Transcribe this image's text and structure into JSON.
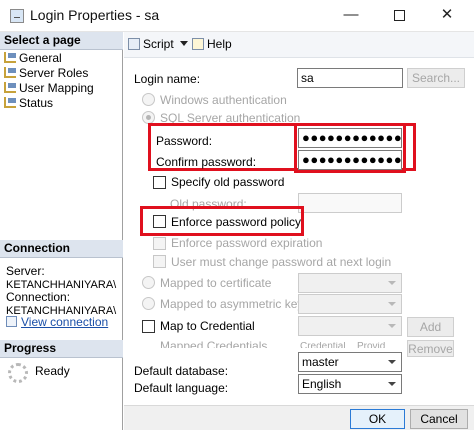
{
  "window": {
    "title": "Login Properties - sa",
    "minimize": "—",
    "close": "✕"
  },
  "left": {
    "select_page_header": "Select a page",
    "pages": [
      {
        "label": "General"
      },
      {
        "label": "Server Roles"
      },
      {
        "label": "User Mapping"
      },
      {
        "label": "Status"
      }
    ],
    "connection_header": "Connection",
    "server_label": "Server:",
    "server_value": "KETANCHHANIYARA\\",
    "connection_label": "Connection:",
    "connection_value": "KETANCHHANIYARA\\",
    "view_connection": "View connection",
    "progress_header": "Progress",
    "progress_status": "Ready"
  },
  "toolbar": {
    "script_label": "Script",
    "help_label": "Help"
  },
  "form": {
    "login_name_label": "Login name:",
    "login_name_value": "sa",
    "search_button": "Search...",
    "windows_auth": "Windows authentication",
    "sql_auth": "SQL Server authentication",
    "password_label": "Password:",
    "password_value": "●●●●●●●●●●●●●●●",
    "confirm_label": "Confirm password:",
    "confirm_value": "●●●●●●●●●●●●●●●",
    "specify_old": "Specify old password",
    "old_password_label": "Old password:",
    "enforce_policy": "Enforce password policy",
    "enforce_expiration": "Enforce password expiration",
    "must_change": "User must change password at next login",
    "mapped_cert": "Mapped to certificate",
    "mapped_asym": "Mapped to asymmetric key",
    "map_credential": "Map to Credential",
    "add_button": "Add",
    "mapped_credentials": "Mapped Credentials",
    "credential_col": "Credential",
    "provider_col": "Provid",
    "remove_button": "Remove",
    "default_db_label": "Default database:",
    "default_db_value": "master",
    "default_lang_label": "Default language:",
    "default_lang_value": "English"
  },
  "buttons": {
    "ok": "OK",
    "cancel": "Cancel"
  },
  "colors": {
    "highlight": "#e0101e",
    "section_header": "#dde4ee",
    "link": "#1a4fa8"
  }
}
